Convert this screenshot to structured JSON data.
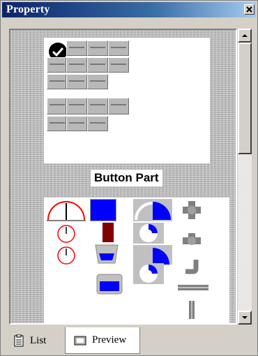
{
  "window": {
    "title": "Property",
    "close_symbol": "x"
  },
  "preview": {
    "caption": "Button Part"
  },
  "tabs": [
    {
      "label": "List",
      "icon": "list-icon",
      "selected": false
    },
    {
      "label": "Preview",
      "icon": "preview-icon",
      "selected": true
    }
  ],
  "colors": {
    "titlebar": "#0a246a",
    "gauge_red": "#ff0000",
    "fill_blue": "#0000ff",
    "dark_red": "#800000"
  }
}
